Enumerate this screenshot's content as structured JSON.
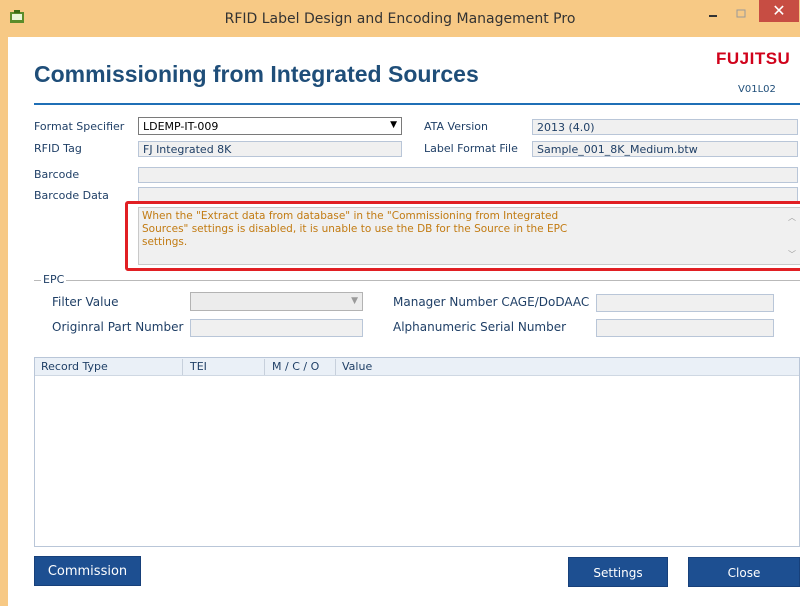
{
  "window": {
    "title": "RFID Label Design and Encoding Management Pro",
    "close_glyph": "✕",
    "colors": {
      "frame": "#f7c985",
      "close": "#c74d43"
    }
  },
  "header": {
    "title": "Commissioning from Integrated Sources",
    "logo": "FUJITSU",
    "version": "V01L02"
  },
  "form": {
    "format_specifier": {
      "label": "Format Specifier",
      "value": "LDEMP-IT-009"
    },
    "ata_version": {
      "label": "ATA Version",
      "value": "2013 (4.0)"
    },
    "rfid_tag": {
      "label": "RFID Tag",
      "value": "FJ Integrated 8K"
    },
    "label_format_file": {
      "label": "Label Format File",
      "value": "Sample_001_8K_Medium.btw"
    },
    "barcode": {
      "label": "Barcode",
      "value": ""
    },
    "barcode_data": {
      "label": "Barcode Data",
      "value": ""
    }
  },
  "message": {
    "text": "When the \"Extract data from database\" in the \"Commissioning from Integrated Sources\" settings is disabled, it is unable to use the DB for the Source in the EPC settings."
  },
  "epc": {
    "legend": "EPC",
    "filter_value": {
      "label": "Filter Value",
      "value": ""
    },
    "manager_number": {
      "label": "Manager Number CAGE/DoDAAC",
      "value": ""
    },
    "original_part_number": {
      "label": "Originral Part Number",
      "value": ""
    },
    "alphanumeric_serial": {
      "label": "Alphanumeric Serial Number",
      "value": ""
    }
  },
  "records": {
    "columns": [
      "Record Type",
      "TEI",
      "M / C / O",
      "Value"
    ],
    "rows": []
  },
  "buttons": {
    "commission": "Commission",
    "settings": "Settings",
    "close": "Close"
  },
  "icons": {
    "app": "app-icon",
    "minimize": "minimize-icon",
    "maximize": "maximize-icon",
    "close": "close-icon",
    "dropdown": "chevron-down-icon"
  }
}
